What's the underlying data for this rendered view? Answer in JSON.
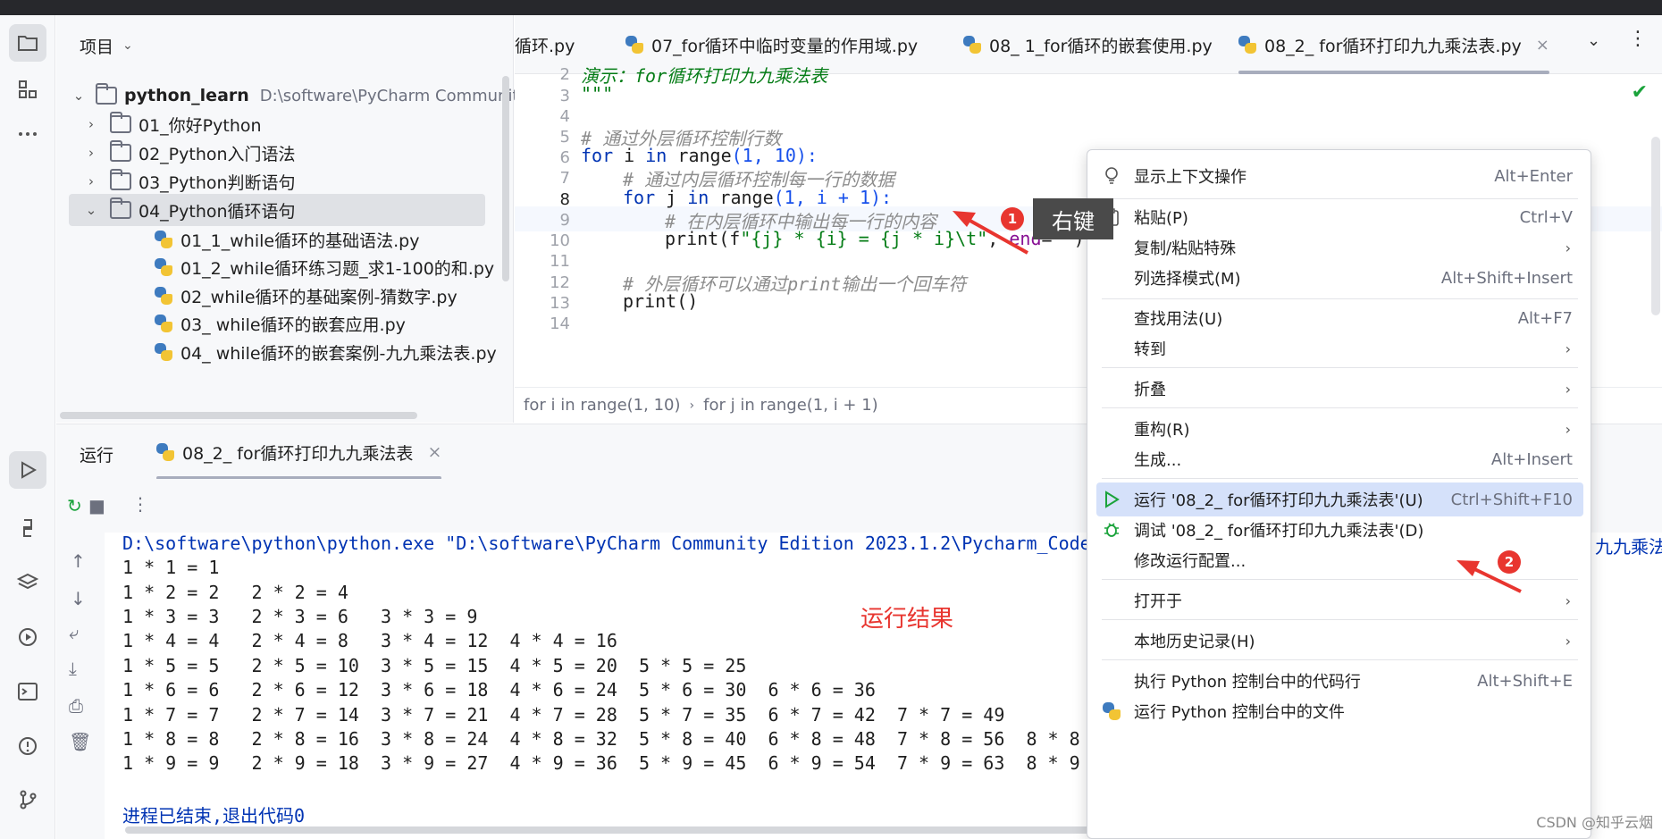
{
  "project": {
    "header": "项目",
    "root": {
      "name": "python_learn",
      "path": "D:\\software\\PyCharm Community"
    },
    "folders": [
      "01_你好Python",
      "02_Python入门语法",
      "03_Python判断语句",
      "04_Python循环语句"
    ],
    "files": [
      "01_1_while循环的基础语法.py",
      "01_2_while循环练习题_求1-100的和.py",
      "02_while循环的基础案例-猜数字.py",
      "03_ while循环的嵌套应用.py",
      "04_ while循环的嵌套案例-九九乘法表.py"
    ]
  },
  "tabs": [
    {
      "label": "循环.py"
    },
    {
      "label": "07_for循环中临时变量的作用域.py"
    },
    {
      "label": "08_ 1_for循环的嵌套使用.py"
    },
    {
      "label": "08_2_ for循环打印九九乘法表.py",
      "close": "×"
    }
  ],
  "editor": {
    "line_numbers": [
      "2",
      "3",
      "4",
      "5",
      "6",
      "7",
      "8",
      "9",
      "10",
      "11",
      "12",
      "13",
      "14"
    ],
    "docstring_fragment": "演示：for循环打印九九乘法表",
    "docstring_close": "\"\"\"",
    "comment_outer": "# 通过外层循环控制行数",
    "comment_inner": "# 通过内层循环控制每一行的数据",
    "comment_print": "# 在内层循环中输出每一行的内容",
    "comment_newline": "# 外层循环可以通过print输出一个回车符",
    "kw_for": "for",
    "kw_in": "in",
    "var_i": "i",
    "var_j": "j",
    "fn_range": "range",
    "outer_args": "(1, 10):",
    "inner_args": "(1, i + 1):",
    "fn_print": "print",
    "print_arg_open": "(f",
    "fstring": "\"{j} * {i} = {j * i}\\t\"",
    "param_end": "end",
    "end_value": "''",
    "print_close": ")",
    "print_empty": "print()",
    "check_mark": "✔"
  },
  "breadcrumb": [
    "for i in range(1, 10)",
    "for j in range(1, i + 1)"
  ],
  "run": {
    "title": "运行",
    "tab_label": "08_2_ for循环打印九九乘法表",
    "tab_close": "×",
    "command": "D:\\software\\python\\python.exe \"D:\\software\\PyCharm Community Edition 2023.1.2\\Pycharm_Code",
    "output": [
      "1 * 1 = 1",
      "1 * 2 = 2   2 * 2 = 4",
      "1 * 3 = 3   2 * 3 = 6   3 * 3 = 9",
      "1 * 4 = 4   2 * 4 = 8   3 * 4 = 12  4 * 4 = 16",
      "1 * 5 = 5   2 * 5 = 10  3 * 5 = 15  4 * 5 = 20  5 * 5 = 25",
      "1 * 6 = 6   2 * 6 = 12  3 * 6 = 18  4 * 6 = 24  5 * 6 = 30  6 * 6 = 36",
      "1 * 7 = 7   2 * 7 = 14  3 * 7 = 21  4 * 7 = 28  5 * 7 = 35  6 * 7 = 42  7 * 7 = 49",
      "1 * 8 = 8   2 * 8 = 16  3 * 8 = 24  4 * 8 = 32  5 * 8 = 40  6 * 8 = 48  7 * 8 = 56  8 * 8",
      "1 * 9 = 9   2 * 9 = 18  3 * 9 = 27  4 * 9 = 36  5 * 9 = 45  6 * 9 = 54  7 * 9 = 63  8 * 9"
    ],
    "exit_message": "进程已结束,退出代码0",
    "command_tail": "九九乘法"
  },
  "context_menu": {
    "items": [
      {
        "label": "显示上下文操作",
        "shortcut": "Alt+Enter",
        "icon": "bulb-icon"
      },
      {
        "label": "粘贴(P)",
        "shortcut": "Ctrl+V",
        "icon": "clipboard-icon"
      },
      {
        "label": "复制/粘贴特殊",
        "submenu": "›"
      },
      {
        "label": "列选择模式(M)",
        "shortcut": "Alt+Shift+Insert"
      },
      {
        "label": "查找用法(U)",
        "shortcut": "Alt+F7"
      },
      {
        "label": "转到",
        "submenu": "›"
      },
      {
        "label": "折叠",
        "submenu": "›"
      },
      {
        "label": "重构(R)",
        "submenu": "›"
      },
      {
        "label": "生成...",
        "shortcut": "Alt+Insert"
      },
      {
        "label": "运行 '08_2_ for循环打印九九乘法表'(U)",
        "shortcut": "Ctrl+Shift+F10",
        "icon": "run-icon"
      },
      {
        "label": "调试 '08_2_ for循环打印九九乘法表'(D)",
        "icon": "debug-icon"
      },
      {
        "label": "修改运行配置..."
      },
      {
        "label": "打开于",
        "submenu": "›"
      },
      {
        "label": "本地历史记录(H)",
        "submenu": "›"
      },
      {
        "label": "执行 Python 控制台中的代码行",
        "shortcut": "Alt+Shift+E"
      },
      {
        "label": "运行 Python 控制台中的文件",
        "icon": "python-icon"
      }
    ]
  },
  "annotations": {
    "badge1": "1",
    "badge2": "2",
    "right_click_label": "右键",
    "result_label": "运行结果"
  },
  "watermark": "CSDN @知乎云烟",
  "colors": {
    "accent_red": "#e8352f",
    "menu_highlight": "#d5e1fa",
    "keyword": "#0033b3"
  }
}
